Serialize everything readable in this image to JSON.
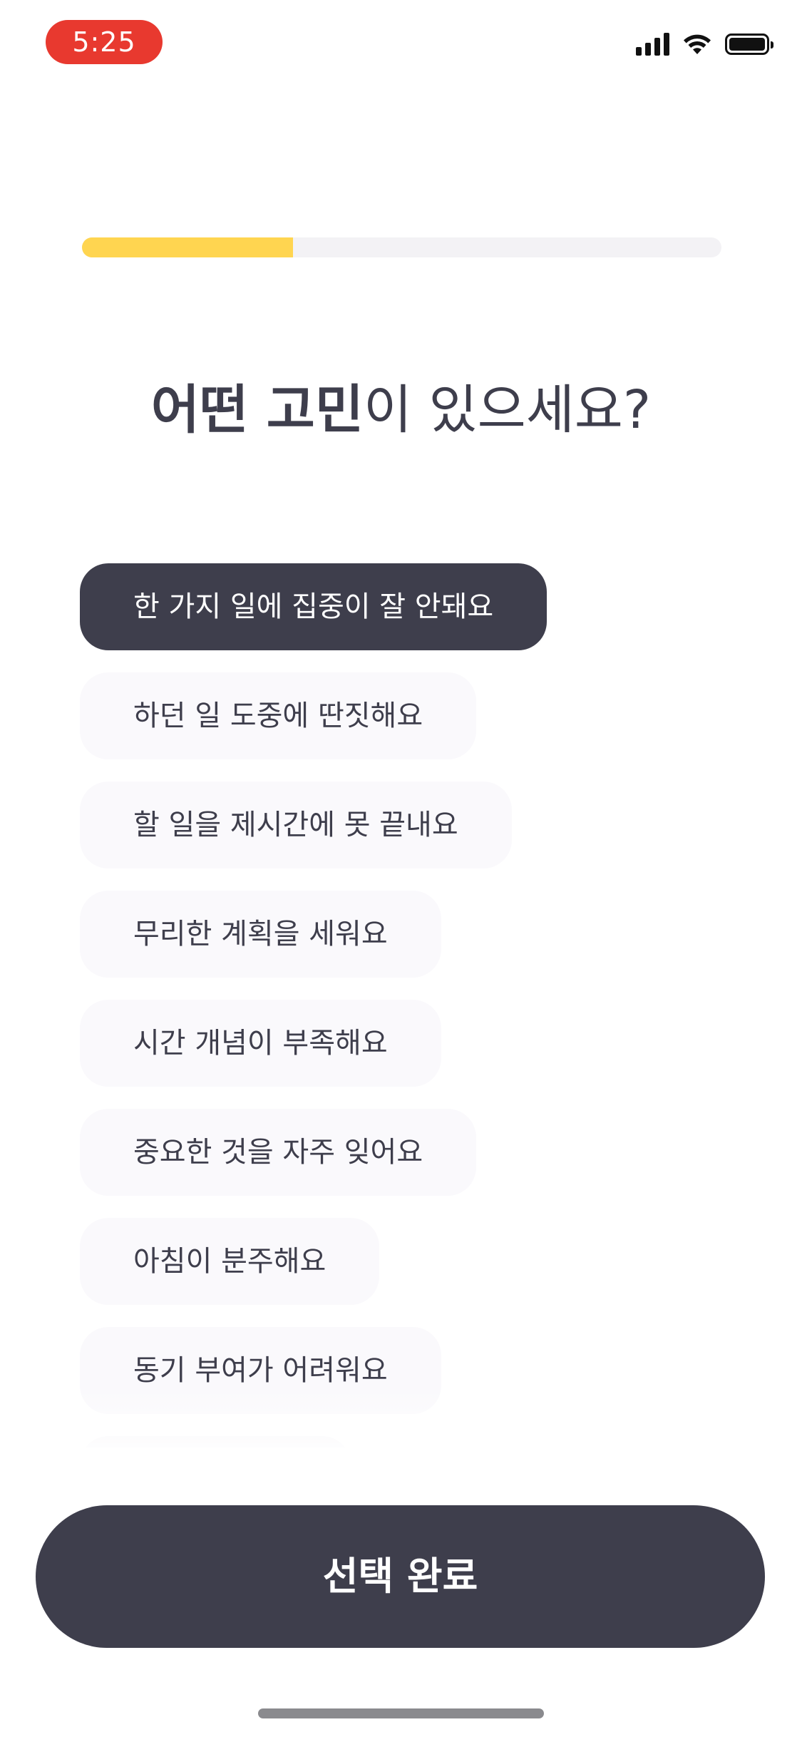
{
  "status_bar": {
    "time": "5:25",
    "icons": [
      "cellular-signal-icon",
      "wifi-icon",
      "battery-icon"
    ]
  },
  "progress": {
    "fraction": 0.33
  },
  "question": {
    "strong": "어떤 고민",
    "rest": "이 있으세요?"
  },
  "options": [
    {
      "label": "한 가지 일에 집중이 잘 안돼요",
      "selected": true
    },
    {
      "label": "하던 일 도중에 딴짓해요",
      "selected": false
    },
    {
      "label": "할 일을 제시간에 못 끝내요",
      "selected": false
    },
    {
      "label": "무리한 계획을 세워요",
      "selected": false
    },
    {
      "label": "시간 개념이 부족해요",
      "selected": false
    },
    {
      "label": "중요한 것을 자주 잊어요",
      "selected": false
    },
    {
      "label": "아침이 분주해요",
      "selected": false
    },
    {
      "label": "동기 부여가 어려워요",
      "selected": false
    }
  ],
  "confirm_button": {
    "label": "선택 완료"
  },
  "colors": {
    "accent": "#ffd550",
    "dark": "#3e3e4c",
    "option_bg": "#faf9fc",
    "status_time_bg": "#e8392f"
  }
}
